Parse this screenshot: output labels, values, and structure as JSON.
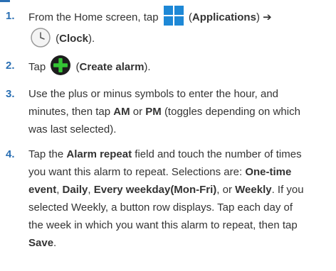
{
  "step1": {
    "num": "1.",
    "t1": "From the Home screen, tap",
    "app_label": "Applications",
    "arrow": "➔",
    "clock_label": "Clock",
    "open": "(",
    "close": ").",
    "close2": ")"
  },
  "step2": {
    "num": "2.",
    "t1": "Tap",
    "label": "Create alarm",
    "open": "(",
    "close": ")."
  },
  "step3": {
    "num": "3.",
    "line1": "Use the plus or minus symbols to enter the hour, and",
    "t1": "minutes, then tap",
    "am": "AM",
    "or": "or",
    "pm": "PM",
    "t2": "(toggles depending on which",
    "line3": "was last selected)."
  },
  "step4": {
    "num": "4.",
    "t1": "Tap the",
    "field": "Alarm repeat",
    "t2": "field and touch the number of times",
    "line2": "you want this alarm to repeat. Selections are:",
    "opt1": "One-time",
    "opt1b": "event",
    "opt2": "Daily",
    "opt3": "Every weekday(Mon-Fri)",
    "or": "or",
    "opt4": "Weekly",
    "t3": ". If you",
    "line4": "selected Weekly, a button row displays. Tap each day of",
    "line5": "the week in which you want this alarm to repeat, then tap",
    "save": "Save",
    "period": ".",
    "comma": ","
  },
  "icons": {
    "applications": "applications-grid-icon",
    "clock": "clock-icon",
    "create_alarm": "plus-circle-icon"
  },
  "colors": {
    "accent": "#2a6fb3",
    "apps_icon": "#1e88d6",
    "plus_icon_bg": "#1d1d1d",
    "plus_icon_fg": "#35c435"
  }
}
